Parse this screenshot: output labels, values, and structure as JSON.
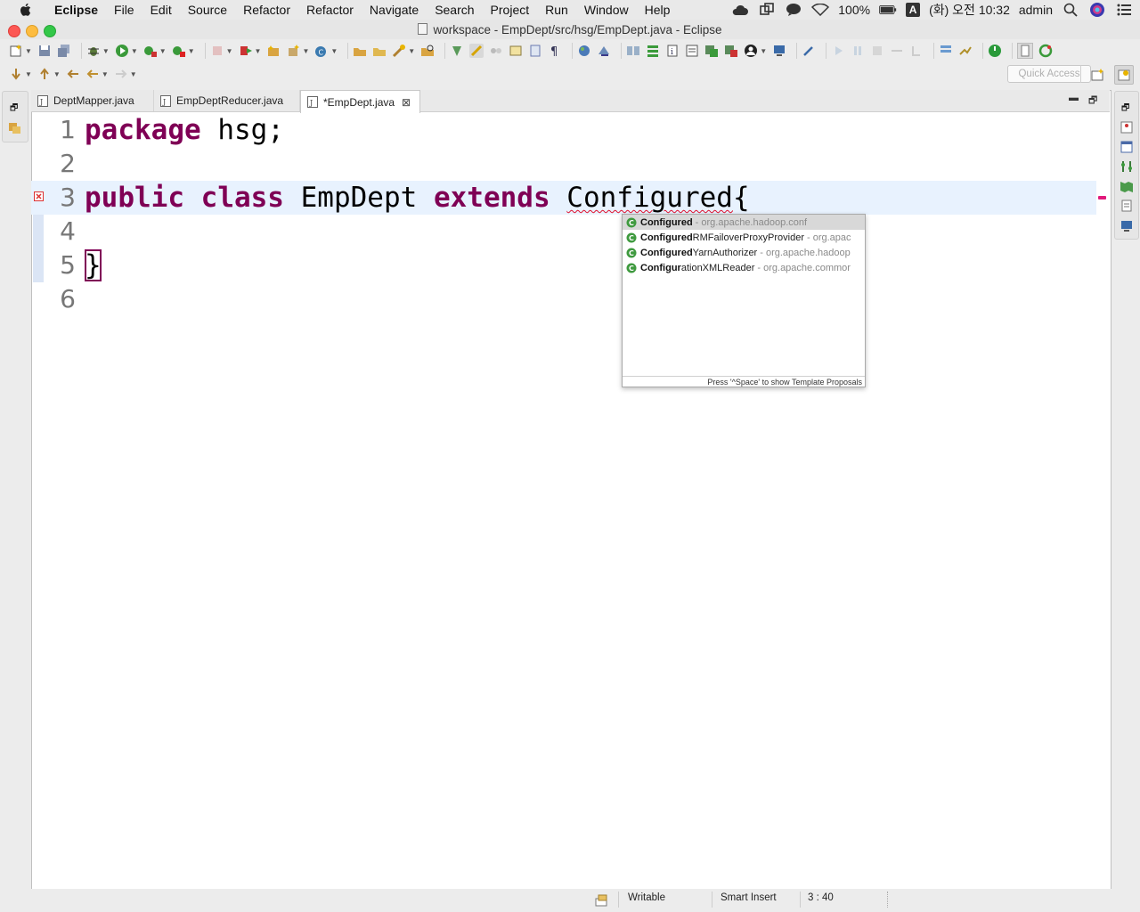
{
  "menubar": {
    "app_name": "Eclipse",
    "items": [
      "File",
      "Edit",
      "Source",
      "Refactor",
      "Refactor",
      "Navigate",
      "Search",
      "Project",
      "Run",
      "Window",
      "Help"
    ],
    "battery": "100%",
    "input_source": "A",
    "clock": "(화) 오전 10:32",
    "user": "admin"
  },
  "window": {
    "title": "workspace - EmpDept/src/hsg/EmpDept.java - Eclipse"
  },
  "toolbar": {
    "quick_access_placeholder": "Quick Access"
  },
  "editor": {
    "tabs": [
      {
        "label": "DeptMapper.java",
        "active": false,
        "dirty": false
      },
      {
        "label": "EmpDeptReducer.java",
        "active": false,
        "dirty": false
      },
      {
        "label": "*EmpDept.java",
        "active": true,
        "dirty": true
      }
    ],
    "lines": [
      {
        "num": "1",
        "tokens": [
          {
            "t": "package",
            "kw": true
          },
          {
            "t": " hsg;"
          }
        ]
      },
      {
        "num": "2",
        "tokens": []
      },
      {
        "num": "3",
        "tokens": [
          {
            "t": "public",
            "kw": true
          },
          {
            "t": " "
          },
          {
            "t": "class",
            "kw": true
          },
          {
            "t": " EmpDept "
          },
          {
            "t": "extends",
            "kw": true
          },
          {
            "t": " "
          },
          {
            "t": "Configured",
            "error": true
          },
          {
            "t": "{"
          }
        ],
        "current": true,
        "error": true
      },
      {
        "num": "4",
        "tokens": []
      },
      {
        "num": "5",
        "tokens": [
          {
            "t": "}",
            "boxed": true
          }
        ]
      },
      {
        "num": "6",
        "tokens": []
      }
    ]
  },
  "content_assist": {
    "proposals": [
      {
        "match": "Configured",
        "rest": "",
        "package": "- org.apache.hadoop.conf",
        "selected": true
      },
      {
        "match": "Configured",
        "rest": "RMFailoverProxyProvider",
        "package": "- org.apac",
        "selected": false
      },
      {
        "match": "Configured",
        "rest": "YarnAuthorizer",
        "package": "- org.apache.hadoop",
        "selected": false
      },
      {
        "match": "Configur",
        "rest": "ationXMLReader",
        "package": "- org.apache.commor",
        "selected": false
      }
    ],
    "footer": "Press '^Space' to show Template Proposals"
  },
  "statusbar": {
    "writable": "Writable",
    "insert_mode": "Smart Insert",
    "position": "3 : 40"
  },
  "colors": {
    "keyword": "#7f0055",
    "current_line": "#e8f2fe",
    "error": "#e0102e"
  }
}
